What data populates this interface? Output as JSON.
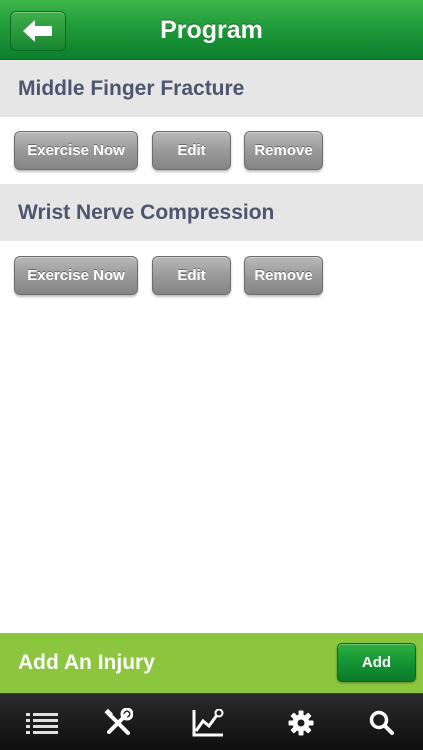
{
  "header": {
    "title": "Program",
    "back_icon": "arrow-left-icon"
  },
  "injuries": [
    {
      "name": "Middle Finger Fracture",
      "exercise_label": "Exercise Now",
      "edit_label": "Edit",
      "remove_label": "Remove"
    },
    {
      "name": "Wrist Nerve Compression",
      "exercise_label": "Exercise Now",
      "edit_label": "Edit",
      "remove_label": "Remove"
    }
  ],
  "add_bar": {
    "label": "Add An Injury",
    "button_label": "Add"
  },
  "tabbar": {
    "tabs": [
      {
        "icon": "list-icon"
      },
      {
        "icon": "tools-icon"
      },
      {
        "icon": "chart-icon"
      },
      {
        "icon": "gear-icon"
      },
      {
        "icon": "search-icon"
      }
    ]
  },
  "colors": {
    "header_green": "#1f9b3a",
    "add_bar_green": "#8cc63f",
    "injury_text": "#4e556e",
    "gray_button": "#9a9a9a",
    "tabbar": "#1a1a1a"
  }
}
